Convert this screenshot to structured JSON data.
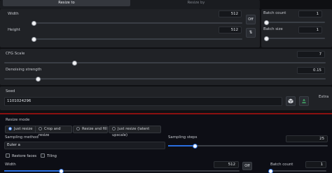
{
  "tabs": {
    "resize_to": "Resize to",
    "resize_by": "Resize by"
  },
  "size": {
    "width_label": "Width",
    "width_value": "512",
    "height_label": "Height",
    "height_value": "512",
    "swap_label": "⇅",
    "off_label": "Off"
  },
  "batch": {
    "count_label": "Batch count",
    "count_value": "1",
    "size_label": "Batch size",
    "size_value": "1"
  },
  "cfg": {
    "label": "CFG Scale",
    "value": "7"
  },
  "denoise": {
    "label": "Denoising strength",
    "value": "0.15"
  },
  "seed": {
    "label": "Seed",
    "value": "1101024296",
    "extra_label": "Extra",
    "dice_icon": "dice-icon",
    "recycle_icon": "recycle-icon"
  },
  "resize_mode": {
    "label": "Resize mode",
    "options": [
      "Just resize",
      "Crop and resize",
      "Resize and fill",
      "Just resize (latent upscale)"
    ],
    "selected": "Just resize"
  },
  "sampling": {
    "method_label": "Sampling method",
    "method_value": "Euler a",
    "steps_label": "Sampling steps",
    "steps_value": "25"
  },
  "options": {
    "restore_faces": "Restore faces",
    "tiling": "Tiling"
  },
  "bottom": {
    "width_label": "Width",
    "width_value": "512",
    "off_label": "Off",
    "batch_count_label": "Batch count",
    "batch_count_value": "1"
  },
  "colors": {
    "accent": "#2a6fe0",
    "panel": "#202226",
    "bg": "#0f1013"
  }
}
